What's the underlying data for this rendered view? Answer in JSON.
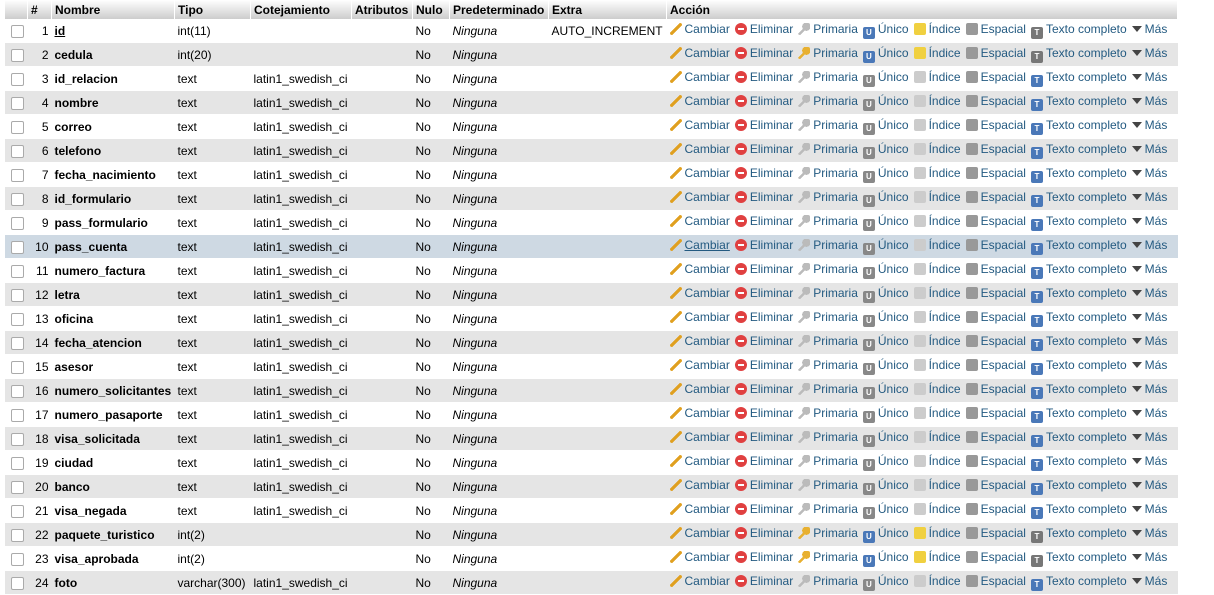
{
  "headers": [
    "",
    "#",
    "Nombre",
    "Tipo",
    "Cotejamiento",
    "Atributos",
    "Nulo",
    "Predeterminado",
    "Extra",
    "Acción"
  ],
  "actions": {
    "change": "Cambiar",
    "drop": "Eliminar",
    "primary": "Primaria",
    "unique": "Único",
    "index": "Índice",
    "spatial": "Espacial",
    "fulltext": "Texto completo",
    "more": "Más"
  },
  "colors": {
    "link": "#235a81",
    "row_even": "#e5e5e5",
    "row_hover": "#ced9e3"
  },
  "rows": [
    {
      "n": "1",
      "name": "id",
      "type": "int(11)",
      "coll": "",
      "null": "No",
      "def": "Ninguna",
      "extra": "AUTO_INCREMENT",
      "pk": true
    },
    {
      "n": "2",
      "name": "cedula",
      "type": "int(20)",
      "coll": "",
      "null": "No",
      "def": "Ninguna",
      "extra": ""
    },
    {
      "n": "3",
      "name": "id_relacion",
      "type": "text",
      "coll": "latin1_swedish_ci",
      "null": "No",
      "def": "Ninguna",
      "extra": ""
    },
    {
      "n": "4",
      "name": "nombre",
      "type": "text",
      "coll": "latin1_swedish_ci",
      "null": "No",
      "def": "Ninguna",
      "extra": ""
    },
    {
      "n": "5",
      "name": "correo",
      "type": "text",
      "coll": "latin1_swedish_ci",
      "null": "No",
      "def": "Ninguna",
      "extra": ""
    },
    {
      "n": "6",
      "name": "telefono",
      "type": "text",
      "coll": "latin1_swedish_ci",
      "null": "No",
      "def": "Ninguna",
      "extra": ""
    },
    {
      "n": "7",
      "name": "fecha_nacimiento",
      "type": "text",
      "coll": "latin1_swedish_ci",
      "null": "No",
      "def": "Ninguna",
      "extra": ""
    },
    {
      "n": "8",
      "name": "id_formulario",
      "type": "text",
      "coll": "latin1_swedish_ci",
      "null": "No",
      "def": "Ninguna",
      "extra": ""
    },
    {
      "n": "9",
      "name": "pass_formulario",
      "type": "text",
      "coll": "latin1_swedish_ci",
      "null": "No",
      "def": "Ninguna",
      "extra": ""
    },
    {
      "n": "10",
      "name": "pass_cuenta",
      "type": "text",
      "coll": "latin1_swedish_ci",
      "null": "No",
      "def": "Ninguna",
      "extra": "",
      "hover": true
    },
    {
      "n": "11",
      "name": "numero_factura",
      "type": "text",
      "coll": "latin1_swedish_ci",
      "null": "No",
      "def": "Ninguna",
      "extra": ""
    },
    {
      "n": "12",
      "name": "letra",
      "type": "text",
      "coll": "latin1_swedish_ci",
      "null": "No",
      "def": "Ninguna",
      "extra": ""
    },
    {
      "n": "13",
      "name": "oficina",
      "type": "text",
      "coll": "latin1_swedish_ci",
      "null": "No",
      "def": "Ninguna",
      "extra": ""
    },
    {
      "n": "14",
      "name": "fecha_atencion",
      "type": "text",
      "coll": "latin1_swedish_ci",
      "null": "No",
      "def": "Ninguna",
      "extra": ""
    },
    {
      "n": "15",
      "name": "asesor",
      "type": "text",
      "coll": "latin1_swedish_ci",
      "null": "No",
      "def": "Ninguna",
      "extra": ""
    },
    {
      "n": "16",
      "name": "numero_solicitantes",
      "type": "text",
      "coll": "latin1_swedish_ci",
      "null": "No",
      "def": "Ninguna",
      "extra": ""
    },
    {
      "n": "17",
      "name": "numero_pasaporte",
      "type": "text",
      "coll": "latin1_swedish_ci",
      "null": "No",
      "def": "Ninguna",
      "extra": ""
    },
    {
      "n": "18",
      "name": "visa_solicitada",
      "type": "text",
      "coll": "latin1_swedish_ci",
      "null": "No",
      "def": "Ninguna",
      "extra": ""
    },
    {
      "n": "19",
      "name": "ciudad",
      "type": "text",
      "coll": "latin1_swedish_ci",
      "null": "No",
      "def": "Ninguna",
      "extra": ""
    },
    {
      "n": "20",
      "name": "banco",
      "type": "text",
      "coll": "latin1_swedish_ci",
      "null": "No",
      "def": "Ninguna",
      "extra": ""
    },
    {
      "n": "21",
      "name": "visa_negada",
      "type": "text",
      "coll": "latin1_swedish_ci",
      "null": "No",
      "def": "Ninguna",
      "extra": ""
    },
    {
      "n": "22",
      "name": "paquete_turistico",
      "type": "int(2)",
      "coll": "",
      "null": "No",
      "def": "Ninguna",
      "extra": ""
    },
    {
      "n": "23",
      "name": "visa_aprobada",
      "type": "int(2)",
      "coll": "",
      "null": "No",
      "def": "Ninguna",
      "extra": ""
    },
    {
      "n": "24",
      "name": "foto",
      "type": "varchar(300)",
      "coll": "latin1_swedish_ci",
      "null": "No",
      "def": "Ninguna",
      "extra": ""
    }
  ]
}
